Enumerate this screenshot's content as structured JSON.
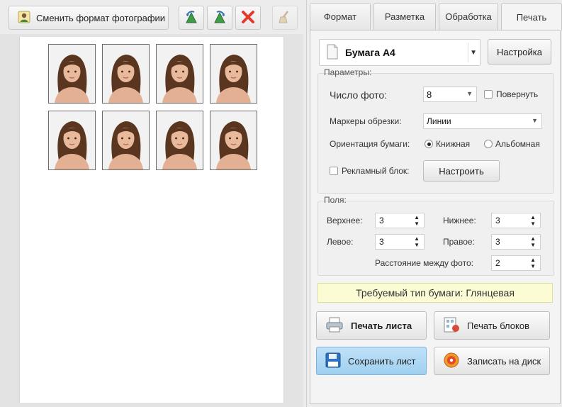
{
  "toolbar": {
    "change_format_label": "Сменить формат фотографии",
    "icons": [
      "person-photo-icon",
      "rotate-left-icon",
      "rotate-right-icon",
      "delete-icon",
      "clean-icon"
    ]
  },
  "preview": {
    "photos_count": 8
  },
  "tabs": [
    {
      "label": "Формат"
    },
    {
      "label": "Разметка"
    },
    {
      "label": "Обработка"
    },
    {
      "label": "Печать"
    }
  ],
  "print": {
    "paper_label": "Бумага А4",
    "settings_button": "Настройка",
    "params": {
      "title": "Параметры:",
      "photo_count_label": "Число фото:",
      "photo_count_value": "8",
      "rotate_label": "Повернуть",
      "crop_marks_label": "Маркеры обрезки:",
      "crop_marks_value": "Линии",
      "orientation_label": "Ориентация бумаги:",
      "orientation_portrait": "Книжная",
      "orientation_landscape": "Альбомная",
      "ad_block_label": "Рекламный блок:",
      "configure_button": "Настроить"
    },
    "fields": {
      "title": "Поля:",
      "top_label": "Верхнее:",
      "top_value": "3",
      "bottom_label": "Нижнее:",
      "bottom_value": "3",
      "left_label": "Левое:",
      "left_value": "3",
      "right_label": "Правое:",
      "right_value": "3",
      "spacing_label": "Расстояние между фото:",
      "spacing_value": "2"
    },
    "paper_type": "Требуемый тип бумаги: Глянцевая",
    "actions": {
      "print_sheet": "Печать листа",
      "print_blocks": "Печать блоков",
      "save_sheet": "Сохранить лист",
      "burn_disk": "Записать на диск"
    }
  },
  "colors": {
    "save_button": "#a9d6f3",
    "paper_type_bg": "#fbfbd4",
    "delete_red": "#e23b2e"
  }
}
